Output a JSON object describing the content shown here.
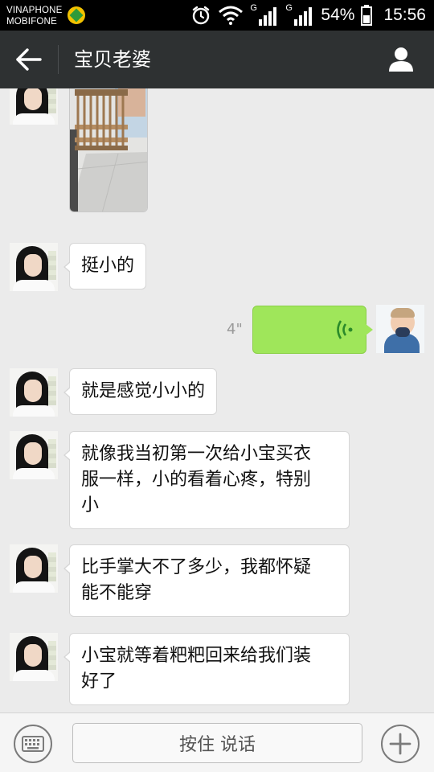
{
  "status_bar": {
    "carrier_1": "VINAPHONE",
    "carrier_2": "MOBIFONE",
    "sim1_network_label": "G",
    "sim2_network_label": "G",
    "battery_percent": "54%",
    "time": "15:56",
    "icons": [
      "alarm-icon",
      "wifi-icon",
      "signal-icon",
      "battery-icon"
    ]
  },
  "header": {
    "title": "宝贝老婆",
    "back_icon": "back-arrow-icon",
    "profile_icon": "person-icon",
    "background_color": "#2e3132"
  },
  "messages": [
    {
      "sender": "contact",
      "type": "image",
      "content": "photo of a wooden baby crib"
    },
    {
      "sender": "contact",
      "type": "text",
      "text": "挺小的"
    },
    {
      "sender": "me",
      "type": "voice",
      "duration": "4\"",
      "color": "#9fe65a"
    },
    {
      "sender": "contact",
      "type": "text",
      "text": "就是感觉小小的"
    },
    {
      "sender": "contact",
      "type": "text",
      "lines": [
        "就像我当初第一次给小宝买衣",
        "服一样，小的看着心疼，特别",
        "小"
      ]
    },
    {
      "sender": "contact",
      "type": "text",
      "lines": [
        "比手掌大不了多少，我都怀疑",
        "能不能穿"
      ]
    },
    {
      "sender": "contact",
      "type": "text",
      "lines": [
        "小宝就等着粑粑回来给我们装",
        "好了"
      ]
    }
  ],
  "input_bar": {
    "hold_to_talk_label": "按住 说话",
    "keyboard_icon": "keyboard-icon",
    "plus_icon": "plus-icon"
  }
}
